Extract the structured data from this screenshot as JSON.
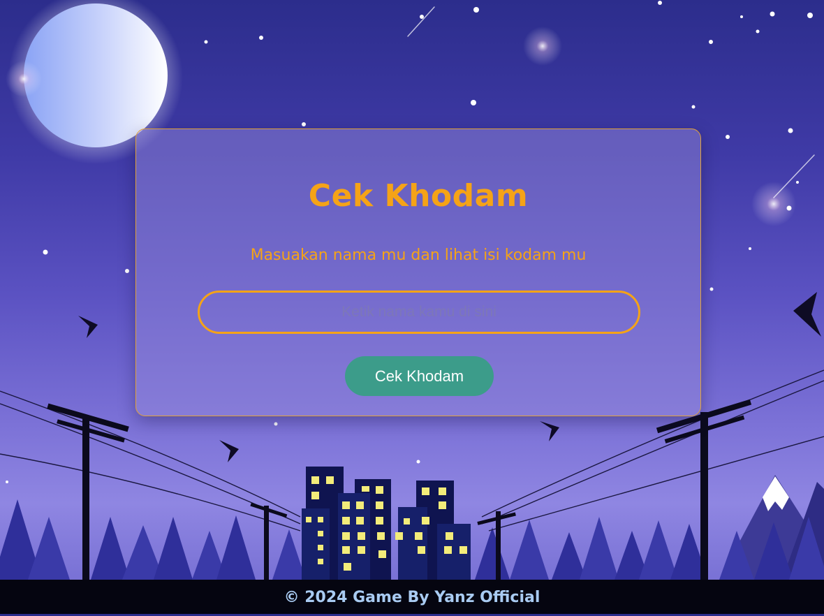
{
  "card": {
    "title": "Cek Khodam",
    "subtitle": "Masuakan nama mu dan lihat isi kodam mu",
    "input_placeholder": "Ketik nama kamu di sini",
    "input_value": "",
    "button_label": "Cek Khodam"
  },
  "footer": {
    "text": "© 2024 Game By Yanz Official"
  },
  "colors": {
    "accent": "#f5a317",
    "button": "#3c9c8a",
    "footer_text": "#a9cbf2",
    "sky_top": "#2c2d8c",
    "sky_bottom": "#8f86e2"
  },
  "icons": [
    "moon-icon",
    "star-icon",
    "bird-icon",
    "utility-pole-icon",
    "building-icon",
    "pine-tree-icon",
    "mountain-icon"
  ]
}
